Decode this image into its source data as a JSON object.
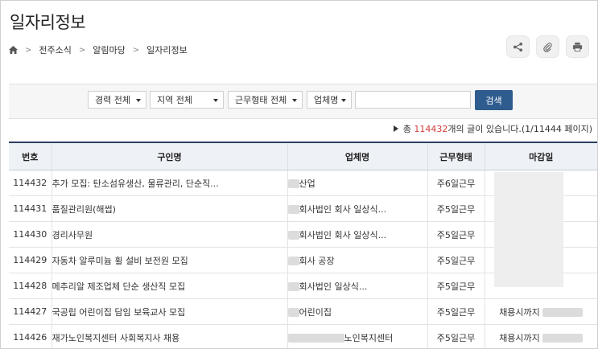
{
  "page": {
    "title": "일자리정보"
  },
  "breadcrumb": [
    "전주소식",
    "알림마당",
    "일자리정보"
  ],
  "actions": [
    "share-icon",
    "paperclip-icon",
    "print-icon"
  ],
  "search": {
    "filters": [
      "경력 전체",
      "지역 전체",
      "근무형태 전체",
      "업체명"
    ],
    "keyword_value": "",
    "button_label": "검색"
  },
  "summary": {
    "prefix": "총",
    "total": "114432",
    "suffix": "개의 글이 있습니다.(1/11444 페이지)"
  },
  "table": {
    "headers": [
      "번호",
      "구인명",
      "업체명",
      "근무형태",
      "마감일"
    ],
    "rows": [
      {
        "no": "114432",
        "title": "추가 모집: 탄소섬유생산, 물류관리, 단순직...",
        "company": "산업",
        "type": "주6일근무",
        "deadline": ""
      },
      {
        "no": "114431",
        "title": "품질관리원(해썹)",
        "company": "회사법인 회사 일상식...",
        "type": "주5일근무",
        "deadline": ""
      },
      {
        "no": "114430",
        "title": "경리사무원",
        "company": "회사법인 회사 일상식...",
        "type": "주5일근무",
        "deadline": ""
      },
      {
        "no": "114429",
        "title": "자동차 알루미늄 휠 설비 보전원 모집",
        "company": "회사 공장",
        "type": "주5일근무",
        "deadline": ""
      },
      {
        "no": "114428",
        "title": "메추리알 제조업체 단순 생산직 모집",
        "company": "회사법인 일상식...",
        "type": "주5일근무",
        "deadline": ""
      },
      {
        "no": "114427",
        "title": "국공립 어린이집 담임 보육교사 모집",
        "company": "어린이집",
        "type": "주5일근무",
        "deadline": "채용시까지"
      },
      {
        "no": "114426",
        "title": "재가노인복지센터 사회복지사 채용",
        "company": "노인복지센터",
        "type": "주5일근무",
        "deadline": "채용시까지"
      }
    ]
  }
}
